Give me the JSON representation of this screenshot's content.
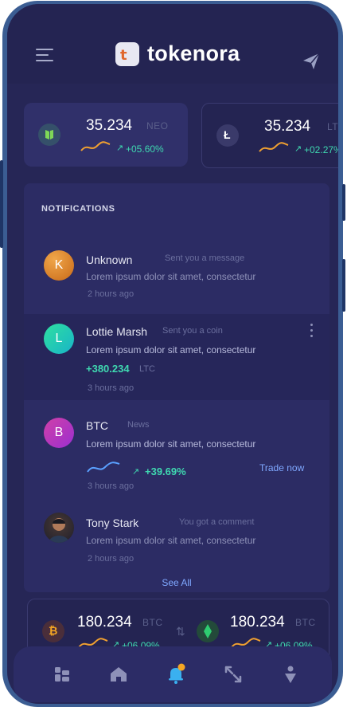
{
  "app": {
    "brand": "tokenora",
    "logo_letter": "t"
  },
  "tickers": [
    {
      "price": "35.234",
      "symbol": "NEO",
      "change": "+05.60%"
    },
    {
      "price": "35.234",
      "symbol": "LTC",
      "change": "+02.27%"
    }
  ],
  "notifications": {
    "title": "NOTIFICATIONS",
    "items": [
      {
        "initial": "K",
        "name": "Unknown",
        "meta": "Sent you a message",
        "desc": "Lorem ipsum dolor sit amet, consectetur",
        "time": "2 hours ago"
      },
      {
        "initial": "L",
        "name": "Lottie Marsh",
        "meta": "Sent you a coin",
        "desc": "Lorem ipsum dolor sit amet, consectetur",
        "amount": "+380.234",
        "unit": "LTC",
        "time": "3 hours ago"
      },
      {
        "initial": "B",
        "name": "BTC",
        "meta": "News",
        "desc": "Lorem ipsum dolor sit amet, consectetur",
        "change": "+39.69%",
        "action": "Trade now",
        "time": "3 hours ago"
      },
      {
        "name": "Tony Stark",
        "meta": "You got a comment",
        "desc": "Lorem ipsum dolor sit amet, consectetur",
        "time": "2 hours ago"
      }
    ],
    "see_all": "See All"
  },
  "bottom_pair": [
    {
      "price": "180.234",
      "symbol": "BTC",
      "change": "+06.09%"
    },
    {
      "price": "180.234",
      "symbol": "BTC",
      "change": "+06.09%"
    }
  ],
  "colors": {
    "accent": "#3fd8b0",
    "link": "#7fa8ff",
    "badge": "#f5a623"
  },
  "tabbar": [
    "dashboard-icon",
    "home-icon",
    "bell-icon",
    "swap-icon",
    "profile-icon"
  ]
}
